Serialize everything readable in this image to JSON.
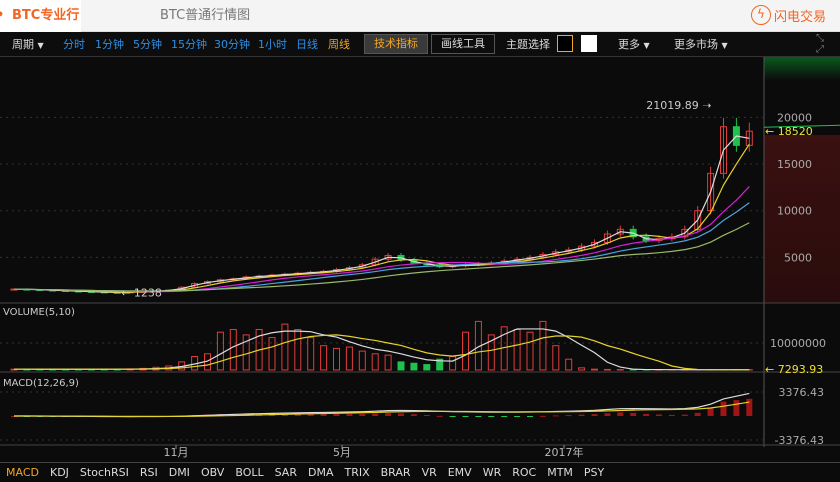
{
  "tabs": {
    "active": "BTC专业行情图",
    "other": "BTC普通行情图",
    "flash": "闪电交易"
  },
  "toolbar": {
    "period": "周期",
    "periods": [
      "分时",
      "1分钟",
      "5分钟",
      "15分钟",
      "30分钟",
      "1小时",
      "日线",
      "周线"
    ],
    "selected_period": "周线",
    "tech": "技术指标",
    "draw": "画线工具",
    "theme": "主题选择",
    "more": "更多",
    "more_market": "更多市场"
  },
  "colors": {
    "up": "#e03c3c",
    "down": "#1fc24c",
    "accent": "#f26522"
  },
  "chart_data": {
    "type": "candlestick",
    "price_ticks": [
      "20000",
      "15000",
      "10000",
      "5000"
    ],
    "max_label": "21019.89",
    "min_label": "1238",
    "last_label": "18520",
    "closes": [
      1600,
      1550,
      1500,
      1450,
      1400,
      1350,
      1300,
      1250,
      1238,
      1300,
      1350,
      1400,
      1500,
      1800,
      2200,
      2400,
      2600,
      2700,
      2900,
      3000,
      3100,
      3200,
      3300,
      3400,
      3500,
      3700,
      3900,
      4200,
      4800,
      5200,
      4700,
      4400,
      4200,
      4000,
      4100,
      4200,
      4300,
      4400,
      4600,
      4800,
      5000,
      5300,
      5600,
      5800,
      6200,
      6600,
      7500,
      8000,
      7200,
      6800,
      7000,
      7200,
      8000,
      10000,
      14000,
      19000,
      17000,
      18520
    ],
    "volume_title": "VOLUME(5,10)",
    "volume_tick": "10000000",
    "volume_last": "7293.93",
    "volumes": [
      300000,
      300000,
      250000,
      250000,
      250000,
      300000,
      300000,
      300000,
      350000,
      400000,
      600000,
      1000000,
      1500000,
      3000000,
      5000000,
      6000000,
      14000000,
      15000000,
      13000000,
      15000000,
      12000000,
      17000000,
      15000000,
      12000000,
      9000000,
      8000000,
      8500000,
      7000000,
      6000000,
      5500000,
      3000000,
      2500000,
      2000000,
      4000000,
      5000000,
      14000000,
      18000000,
      13000000,
      16000000,
      15000000,
      14000000,
      18000000,
      9000000,
      4000000,
      800000,
      300000,
      200000,
      150000,
      100000,
      100000,
      100000,
      100000,
      100000,
      100000,
      100000,
      100000,
      100000,
      100000
    ],
    "macd_title": "MACD(12,26,9)",
    "macd_ticks": [
      "3376.43",
      "-3376.43"
    ],
    "x_ticks": [
      "11月",
      "5月",
      "2017年"
    ]
  },
  "indicators": [
    "MACD",
    "KDJ",
    "StochRSI",
    "RSI",
    "DMI",
    "OBV",
    "BOLL",
    "SAR",
    "DMA",
    "TRIX",
    "BRAR",
    "VR",
    "EMV",
    "WR",
    "ROC",
    "MTM",
    "PSY"
  ],
  "active_indicator": "MACD"
}
